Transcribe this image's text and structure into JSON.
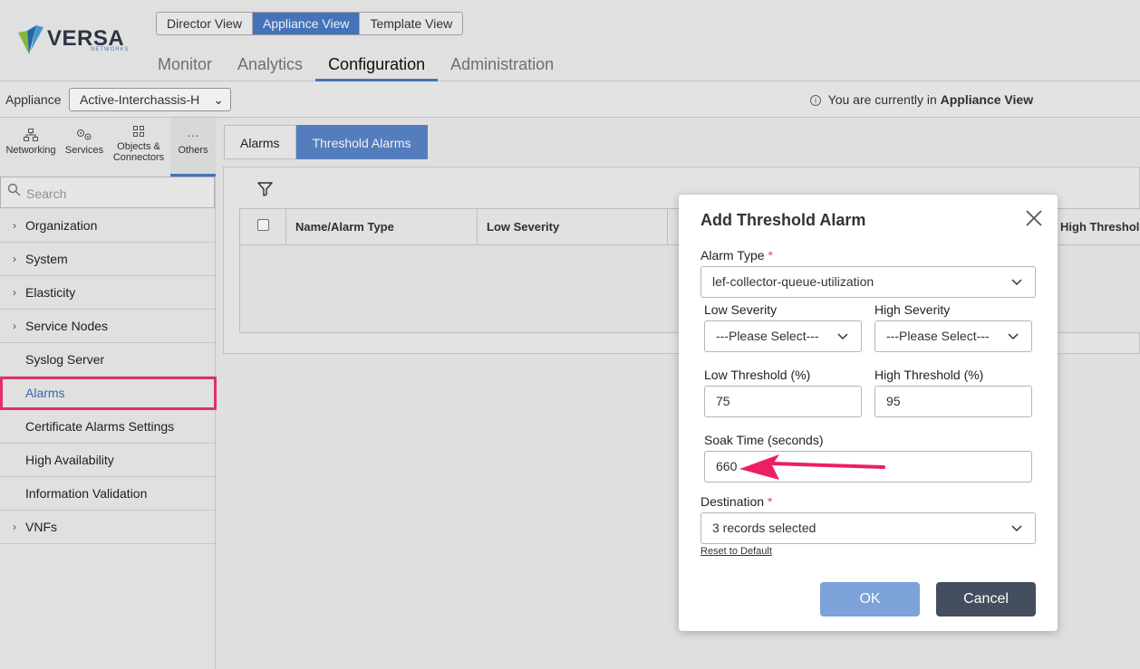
{
  "brand": {
    "name": "VERSA",
    "sub": "NETWORKS"
  },
  "view_switch": [
    "Director View",
    "Appliance View",
    "Template View"
  ],
  "main_nav": [
    "Monitor",
    "Analytics",
    "Configuration",
    "Administration"
  ],
  "appliance": {
    "label": "Appliance",
    "selected": "Active-Interchassis-H",
    "current_view_prefix": "You are currently in",
    "current_view_name": "Appliance View"
  },
  "sidebar": {
    "categories": [
      "Networking",
      "Services",
      "Objects &",
      "Connectors",
      "Others"
    ],
    "search_placeholder": "Search",
    "items": [
      "Organization",
      "System",
      "Elasticity",
      "Service Nodes",
      "Syslog Server",
      "Alarms",
      "Certificate Alarms Settings",
      "High Availability",
      "Information Validation",
      "VNFs"
    ]
  },
  "tabs": [
    "Alarms",
    "Threshold Alarms"
  ],
  "table": {
    "columns": [
      "Name/Alarm Type",
      "Low Severity",
      "High Threshold"
    ]
  },
  "dialog": {
    "title": "Add Threshold Alarm",
    "alarm_type_label": "Alarm Type",
    "alarm_type_value": "lef-collector-queue-utilization",
    "low_severity_label": "Low Severity",
    "low_severity_value": "---Please Select---",
    "high_severity_label": "High Severity",
    "high_severity_value": "---Please Select---",
    "low_threshold_label": "Low Threshold (%)",
    "low_threshold_value": "75",
    "high_threshold_label": "High Threshold (%)",
    "high_threshold_value": "95",
    "soak_time_label": "Soak Time (seconds)",
    "soak_time_value": "660",
    "destination_label": "Destination",
    "destination_value": "3 records selected",
    "reset_label": "Reset to Default",
    "ok_label": "OK",
    "cancel_label": "Cancel"
  },
  "colors": {
    "accent": "#4a7bc6",
    "highlight": "#f0346c",
    "ok": "#7da1d9",
    "cancel": "#454e5e"
  }
}
